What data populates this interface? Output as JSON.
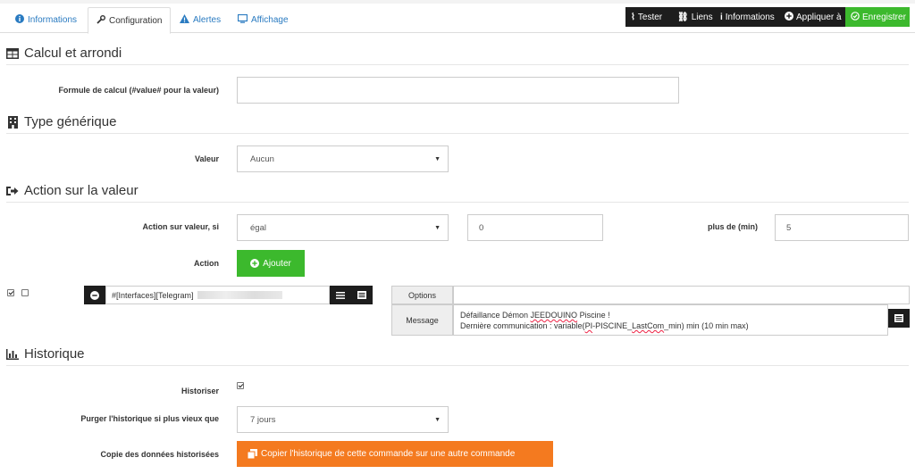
{
  "tabs": [
    {
      "label": "Informations",
      "icon": "info-circle-icon",
      "active": false
    },
    {
      "label": "Configuration",
      "icon": "wrench-icon",
      "active": true
    },
    {
      "label": "Alertes",
      "icon": "warning-icon",
      "active": false
    },
    {
      "label": "Affichage",
      "icon": "desktop-icon",
      "active": false
    }
  ],
  "toolbar": {
    "tester": "Tester",
    "liens": "Liens",
    "informations": "Informations",
    "appliquer": "Appliquer à",
    "enregistrer": "Enregistrer"
  },
  "calcul": {
    "title": "Calcul et arrondi",
    "formule_label": "Formule de calcul (#value# pour la valeur)",
    "formule_value": ""
  },
  "generique": {
    "title": "Type générique",
    "valeur_label": "Valeur",
    "valeur_selected": "Aucun"
  },
  "action": {
    "title": "Action sur la valeur",
    "si_label": "Action sur valeur, si",
    "operator_selected": "égal",
    "compare_value": "0",
    "plus_de_label": "plus de (min)",
    "plus_de_value": "5",
    "action_label": "Action",
    "ajouter": "Ajouter",
    "command_value": "#[Interfaces][Telegram]",
    "options_label": "Options",
    "options_value": "",
    "message_label": "Message",
    "message_line1_a": "Défaillance Démon ",
    "message_line1_b": "JEEDOUINO",
    "message_line1_c": " Piscine !",
    "message_line2_a": "Dernière communication : variable(",
    "message_line2_b": "PI",
    "message_line2_c": "-PISCINE_",
    "message_line2_d": "LastCom",
    "message_line2_e": "_min) min (10 min max)"
  },
  "historique": {
    "title": "Historique",
    "historiser_label": "Historiser",
    "purger_label": "Purger l'historique si plus vieux que",
    "purger_selected": "7 jours",
    "copie_label": "Copie des données historisées",
    "copie_button": "Copier l'historique de cette commande sur une autre commande"
  },
  "colors": {
    "green": "#3cb92d",
    "orange": "#f47a1f",
    "dark": "#1d1d1d",
    "link": "#2a7bc1"
  }
}
